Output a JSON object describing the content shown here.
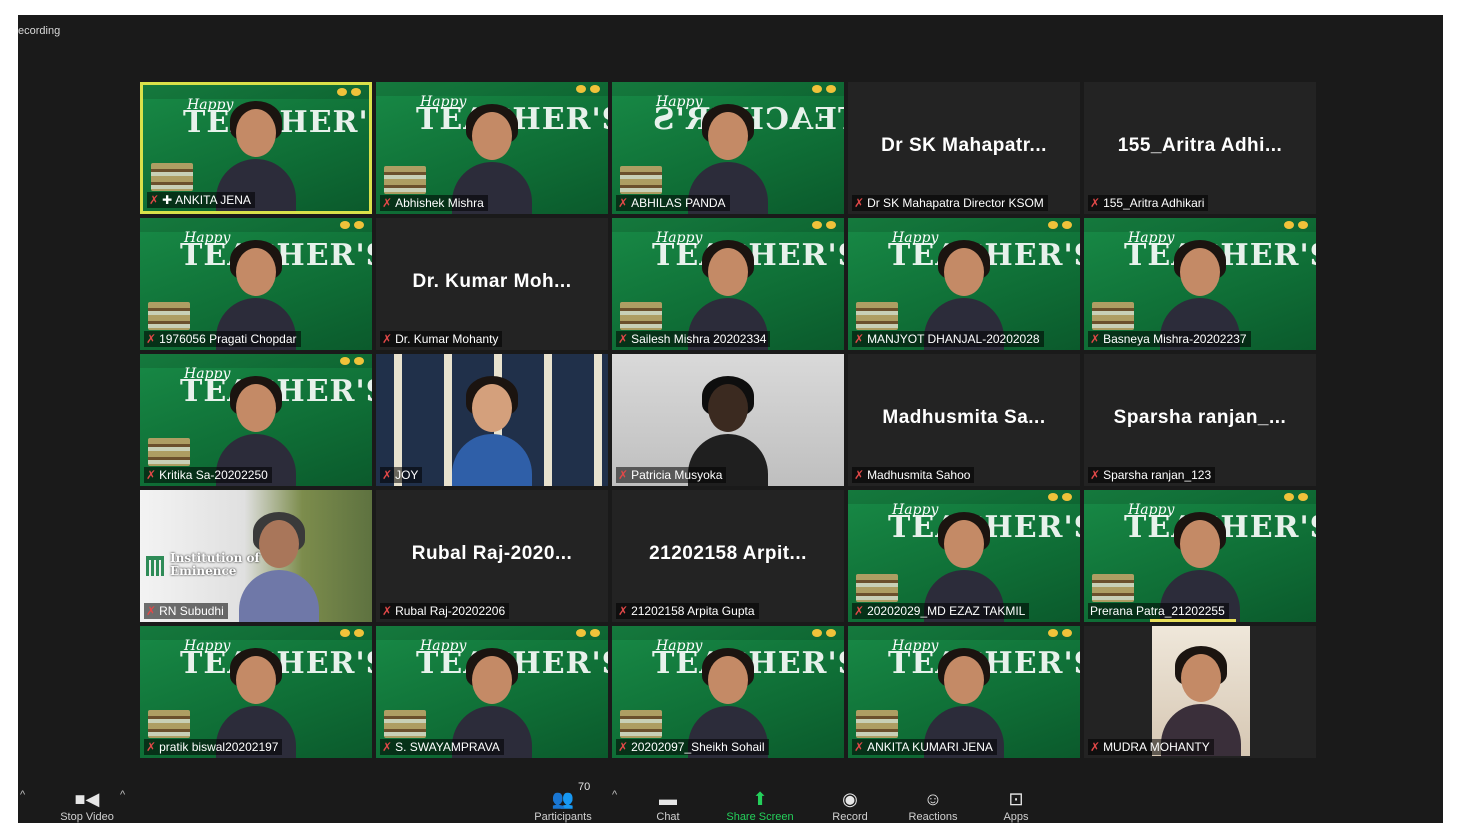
{
  "app": {
    "recording_label": "ecording"
  },
  "banner": {
    "happy": "Happy",
    "word": "TEACHER'S"
  },
  "tiles": [
    {
      "name": "ANKITA JENA",
      "video": true,
      "bg": "green",
      "active": true,
      "pinned": true
    },
    {
      "name": "Abhishek Mishra",
      "video": true,
      "bg": "green"
    },
    {
      "name": "ABHILAS PANDA",
      "video": true,
      "bg": "green",
      "mirrored": true
    },
    {
      "name": "Dr SK Mahapatra Director KSOM",
      "video": false,
      "display": "Dr SK Mahapatr..."
    },
    {
      "name": "155_Aritra Adhikari",
      "video": false,
      "display": "155_Aritra  Adhi..."
    },
    {
      "name": "1976056 Pragati Chopdar",
      "video": true,
      "bg": "green"
    },
    {
      "name": "Dr. Kumar Mohanty",
      "video": false,
      "display": "Dr. Kumar  Moh..."
    },
    {
      "name": "Sailesh Mishra 20202334",
      "video": true,
      "bg": "green"
    },
    {
      "name": "MANJYOT DHANJAL-20202028",
      "video": true,
      "bg": "green"
    },
    {
      "name": "Basneya Mishra-20202237",
      "video": true,
      "bg": "green"
    },
    {
      "name": "Kritika Sa-20202250",
      "video": true,
      "bg": "green"
    },
    {
      "name": "JOY",
      "video": true,
      "bg": "curtain"
    },
    {
      "name": "Patricia Musyoka",
      "video": true,
      "bg": "gray"
    },
    {
      "name": "Madhusmita Sahoo",
      "video": false,
      "display": "Madhusmita  Sa..."
    },
    {
      "name": "Sparsha ranjan_123",
      "video": false,
      "display": "Sparsha  ranjan_..."
    },
    {
      "name": "RN Subudhi",
      "video": true,
      "bg": "iin"
    },
    {
      "name": "Rubal Raj-20202206",
      "video": false,
      "display": "Rubal  Raj-2020..."
    },
    {
      "name": "21202158 Arpita Gupta",
      "video": false,
      "display": "21202158  Arpit..."
    },
    {
      "name": "20202029_MD EZAZ TAKMIL",
      "video": true,
      "bg": "green"
    },
    {
      "name": "Prerana Patra_21202255",
      "video": true,
      "bg": "green",
      "speaking": true
    },
    {
      "name": "pratik biswal20202197",
      "video": true,
      "bg": "green"
    },
    {
      "name": "S. SWAYAMPRAVA",
      "video": true,
      "bg": "green"
    },
    {
      "name": "20202097_Sheikh Sohail",
      "video": true,
      "bg": "green"
    },
    {
      "name": "ANKITA KUMARI JENA",
      "video": true,
      "bg": "green"
    },
    {
      "name": "MUDRA MOHANTY",
      "video": true,
      "bg": "portrait"
    }
  ],
  "iin": {
    "line1": "Institution of",
    "line2": "Eminence"
  },
  "toolbar": {
    "stop_video": "Stop Video",
    "participants": "Participants",
    "participants_count": "70",
    "chat": "Chat",
    "share_screen": "Share Screen",
    "record": "Record",
    "reactions": "Reactions",
    "apps": "Apps"
  },
  "colors": {
    "accent_green": "#24d05b",
    "active_border": "#d9e14a",
    "muted_mic": "#e24848"
  }
}
